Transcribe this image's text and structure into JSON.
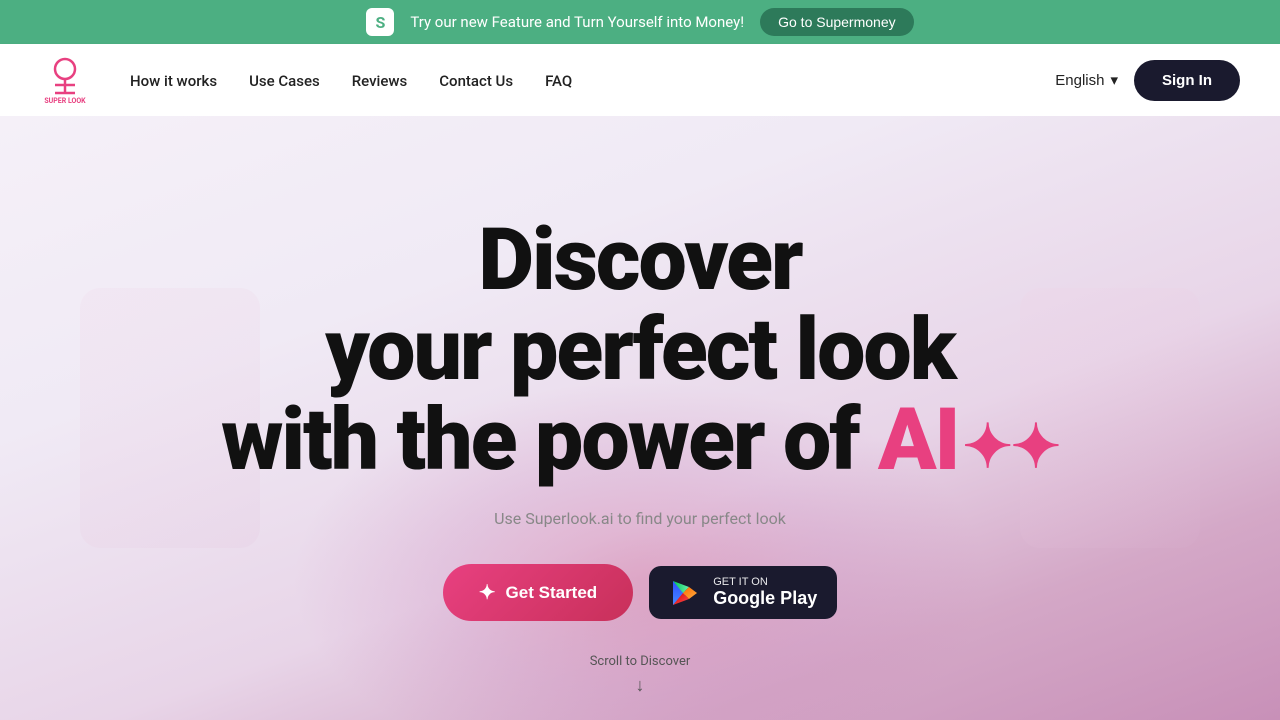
{
  "announcement": {
    "icon_label": "S",
    "text": "Try our new Feature and Turn Yourself into Money!",
    "button_label": "Go to Supermoney"
  },
  "navbar": {
    "logo_alt": "SuperLook",
    "links": [
      {
        "label": "How it works",
        "id": "how-it-works"
      },
      {
        "label": "Use Cases",
        "id": "use-cases"
      },
      {
        "label": "Reviews",
        "id": "reviews"
      },
      {
        "label": "Contact Us",
        "id": "contact"
      },
      {
        "label": "FAQ",
        "id": "faq"
      }
    ],
    "language": "English",
    "sign_in_label": "Sign In"
  },
  "hero": {
    "title_line1": "Discover",
    "title_line2": "your perfect look",
    "title_line3_prefix": "with the power of ",
    "title_line3_ai": "AI",
    "subtitle": "Use Superlook.ai to find your perfect look",
    "get_started_label": "Get Started",
    "google_play_small": "GET IT ON",
    "google_play_large": "Google Play",
    "scroll_label": "Scroll to Discover"
  }
}
